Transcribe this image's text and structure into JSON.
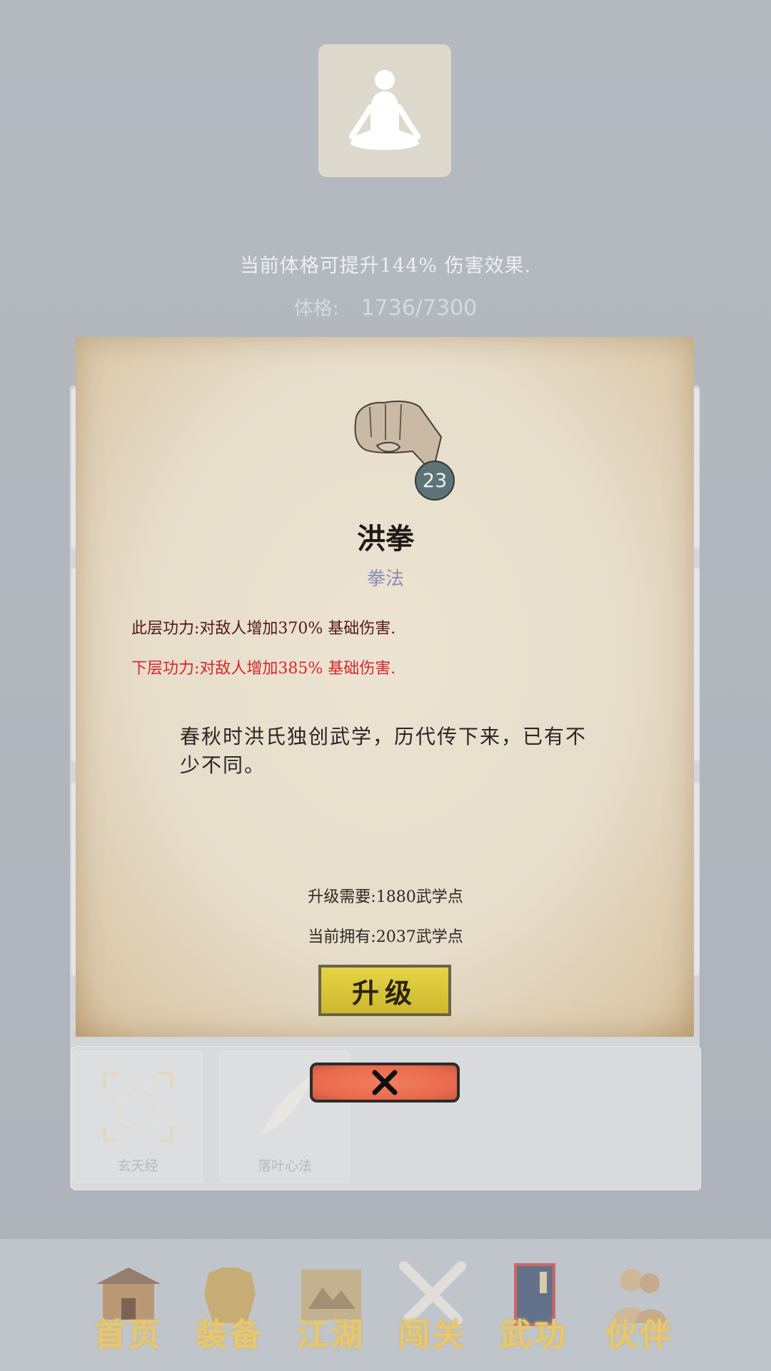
{
  "header": {
    "avatar_icon": "meditation-figure-icon",
    "bonus_text": "当前体格可提升144% 伤害效果.",
    "stat_label": "体格:",
    "stat_value": "1736/7300"
  },
  "skill_detail": {
    "icon": "fist-icon",
    "level": "23",
    "name": "洪拳",
    "type": "拳法",
    "power_current": "此层功力:对敌人增加370% 基础伤害.",
    "power_next": "下层功力:对敌人增加385% 基础伤害.",
    "description": "春秋时洪氏独创武学，历代传下来，已有不少不同。",
    "upgrade_cost": "升级需要:1880武学点",
    "points_owned": "当前拥有:2037武学点",
    "upgrade_label": "升级",
    "close_icon": "close-x-icon"
  },
  "skill_tray": {
    "items": [
      {
        "label": "玄天经",
        "icon": "xuan-seal-icon"
      },
      {
        "label": "落叶心法",
        "icon": "leaf-icon"
      }
    ]
  },
  "nav": {
    "items": [
      {
        "label": "首页",
        "icon": "house-icon"
      },
      {
        "label": "装备",
        "icon": "armor-icon"
      },
      {
        "label": "江湖",
        "icon": "map-scroll-icon"
      },
      {
        "label": "闯关",
        "icon": "crossed-swords-icon"
      },
      {
        "label": "武功",
        "icon": "book-icon"
      },
      {
        "label": "伙伴",
        "icon": "companions-icon"
      }
    ]
  },
  "colors": {
    "power_next": "#d8262a",
    "power_current": "#541714",
    "skill_type": "#8f8ab8",
    "nav_text": "#e6c870",
    "upgrade_button": "#e0cc3e",
    "close_button": "#ec7152"
  }
}
